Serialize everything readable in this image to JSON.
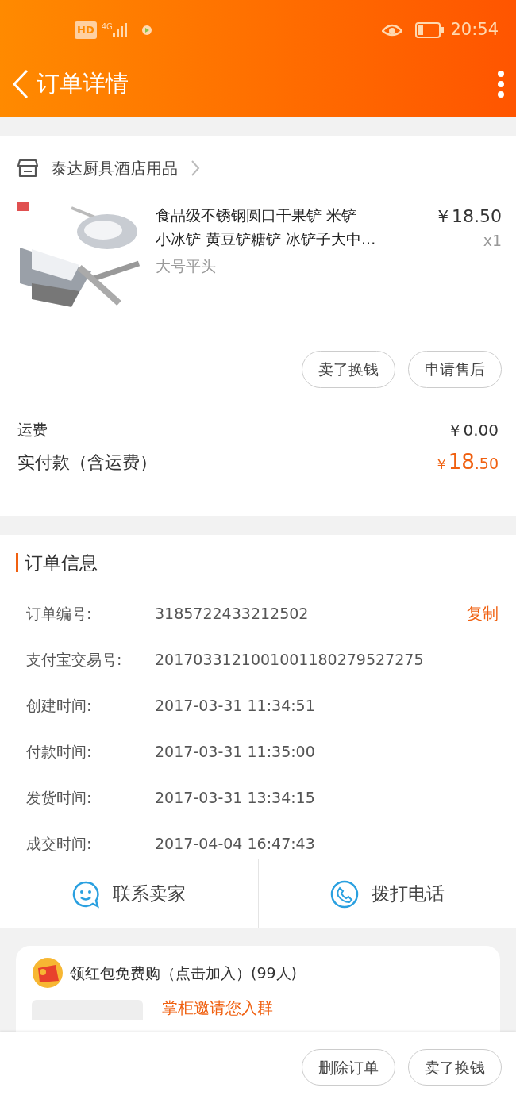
{
  "status_bar": {
    "time": "20:54",
    "hd": "HD",
    "network": "4G"
  },
  "header": {
    "title": "订单详情"
  },
  "shop": {
    "name": "泰达厨具酒店用品"
  },
  "item": {
    "kind": "picture",
    "title_lines": [
      "食品级不锈钢圆口干果铲 米铲",
      "小冰铲 黄豆铲糖铲 冰铲子大中..."
    ],
    "variant": "大号平头",
    "price": "￥18.50",
    "quantity": "x1",
    "actions": [
      "卖了换钱",
      "申请售后"
    ]
  },
  "totals": [
    {
      "label": "运费",
      "value": "￥0.00",
      "kind": "plain"
    },
    {
      "label": "实付款（含运费）",
      "currency": "￥",
      "integer": "18",
      "decimal": ".50",
      "kind": "total"
    }
  ],
  "order_info": {
    "title": "订单信息",
    "copy_label": "复制",
    "rows": [
      {
        "label": "订单编号:",
        "value": "3185722433212502"
      },
      {
        "label": "支付宝交易号:",
        "value": "2017033121001001180279527275"
      },
      {
        "label": "创建时间:",
        "value": "2017-03-31 11:34:51"
      },
      {
        "label": "付款时间:",
        "value": "2017-03-31 11:35:00"
      },
      {
        "label": "发货时间:",
        "value": "2017-03-31 13:34:15"
      },
      {
        "label": "成交时间:",
        "value": "2017-04-04 16:47:43"
      }
    ]
  },
  "contact": [
    {
      "label": "联系卖家",
      "kind": "chat"
    },
    {
      "label": "拨打电话",
      "kind": "phone"
    }
  ],
  "group": {
    "title": "领红包免费购（点击加入）(99人)",
    "invite": "掌柜邀请您入群"
  },
  "footer_buttons": [
    "删除订单",
    "卖了换钱"
  ]
}
